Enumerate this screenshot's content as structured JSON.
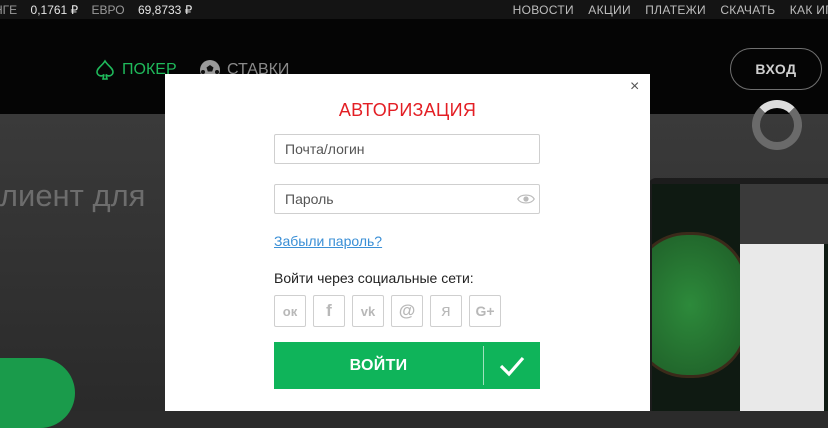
{
  "topbar": {
    "rates": [
      {
        "label": "НГЕ",
        "value": "0,1761 ₽"
      },
      {
        "label": "ЕВРО",
        "value": "69,8733 ₽"
      }
    ],
    "nav": [
      "НОВОСТИ",
      "АКЦИИ",
      "ПЛАТЕЖИ",
      "СКАЧАТЬ",
      "КАК ИГ"
    ]
  },
  "header": {
    "poker": "ПОКЕР",
    "bets": "СТАВКИ",
    "login": "ВХОД",
    "accent": "#1fb95b"
  },
  "hero": {
    "title": "клиент для"
  },
  "modal": {
    "title": "АВТОРИЗАЦИЯ",
    "close": "×",
    "login_placeholder": "Почта/логин",
    "password_placeholder": "Пароль",
    "forgot": "Забыли пароль?",
    "social_label": "Войти через социальные сети:",
    "socials": [
      {
        "icon": "odnoklassniki-icon",
        "glyph": "ок"
      },
      {
        "icon": "facebook-icon",
        "glyph": "f"
      },
      {
        "icon": "vk-icon",
        "glyph": "vk"
      },
      {
        "icon": "mail-icon",
        "glyph": "@"
      },
      {
        "icon": "yandex-icon",
        "glyph": "я"
      },
      {
        "icon": "google-plus-icon",
        "glyph": "G+"
      }
    ],
    "submit": "ВОЙТИ",
    "title_color": "#e31e24",
    "submit_color": "#0fb45a"
  }
}
